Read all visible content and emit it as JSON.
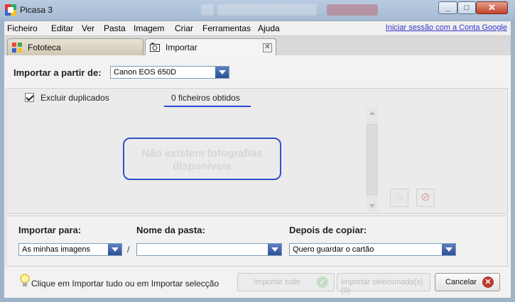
{
  "window": {
    "title": "Picasa 3"
  },
  "menu": {
    "items": [
      "Ficheiro",
      "Editar",
      "Ver",
      "Pasta",
      "Imagem",
      "Criar",
      "Ferramentas",
      "Ajuda"
    ],
    "signin": "Iniciar sessão com a Conta Google"
  },
  "tabs": [
    {
      "label": "Fototeca",
      "active": false
    },
    {
      "label": "Importar",
      "active": true
    }
  ],
  "import_from": {
    "label": "Importar a partir de:",
    "value": "Canon EOS 650D"
  },
  "options": {
    "exclude_duplicates_label": "Excluir duplicados",
    "exclude_duplicates_checked": true,
    "files_count": "0 ficheiros obtidos",
    "empty_message": "Não existem fotografias disponíveis"
  },
  "destination": {
    "import_to_label": "Importar para:",
    "import_to_value": "As minhas imagens",
    "folder_label": "Nome da pasta:",
    "folder_value": "",
    "separator": "/",
    "after_copy_label": "Depois de copiar:",
    "after_copy_value": "Quero guardar o cartão"
  },
  "footer": {
    "hint": "Clique em Importar tudo ou em Importar selecção",
    "import_all": "Importar tudo",
    "import_selected": "Importar selecionada(s) (0)",
    "cancel": "Cancelar"
  },
  "colors": {
    "accent_line": "#2b49d6",
    "cancel_icon": "#b83b2c"
  }
}
